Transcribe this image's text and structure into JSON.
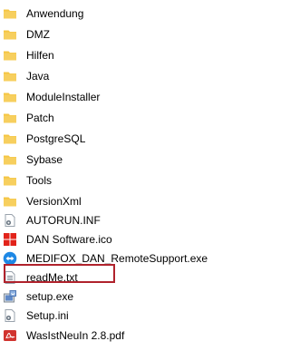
{
  "file_list": {
    "items": [
      {
        "name": "Anwendung",
        "type": "folder",
        "icon": "folder-icon"
      },
      {
        "name": "DMZ",
        "type": "folder",
        "icon": "folder-icon"
      },
      {
        "name": "Hilfen",
        "type": "folder",
        "icon": "folder-icon"
      },
      {
        "name": "Java",
        "type": "folder",
        "icon": "folder-icon"
      },
      {
        "name": "ModuleInstaller",
        "type": "folder",
        "icon": "folder-icon"
      },
      {
        "name": "Patch",
        "type": "folder",
        "icon": "folder-icon"
      },
      {
        "name": "PostgreSQL",
        "type": "folder",
        "icon": "folder-icon"
      },
      {
        "name": "Sybase",
        "type": "folder",
        "icon": "folder-icon"
      },
      {
        "name": "Tools",
        "type": "folder",
        "icon": "folder-icon"
      },
      {
        "name": "VersionXml",
        "type": "folder",
        "icon": "folder-icon"
      },
      {
        "name": "AUTORUN.INF",
        "type": "file",
        "icon": "settings-file-icon"
      },
      {
        "name": "DAN Software.ico",
        "type": "file",
        "icon": "ico-file-icon"
      },
      {
        "name": "MEDIFOX_DAN_RemoteSupport.exe",
        "type": "file",
        "icon": "remote-support-icon"
      },
      {
        "name": "readMe.txt",
        "type": "file",
        "icon": "text-file-icon"
      },
      {
        "name": "setup.exe",
        "type": "file",
        "icon": "installer-icon",
        "highlighted": true
      },
      {
        "name": "Setup.ini",
        "type": "file",
        "icon": "settings-file-icon"
      },
      {
        "name": "WasIstNeuIn 2.8.pdf",
        "type": "file",
        "icon": "pdf-file-icon"
      }
    ]
  },
  "colors": {
    "folder": "#f5c543",
    "highlight_border": "#b0222c",
    "pdf": "#d1342f",
    "ico_red": "#e2231a",
    "remote_blue": "#1e88e5"
  }
}
